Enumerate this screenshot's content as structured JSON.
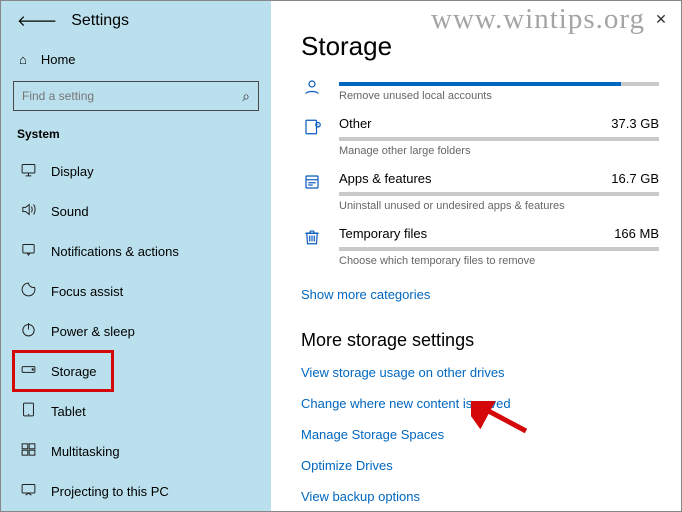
{
  "watermark": "www.wintips.org",
  "app_title": "Settings",
  "home_label": "Home",
  "search_placeholder": "Find a setting",
  "group_label": "System",
  "nav": [
    {
      "id": "display",
      "label": "Display"
    },
    {
      "id": "sound",
      "label": "Sound"
    },
    {
      "id": "notifications",
      "label": "Notifications & actions"
    },
    {
      "id": "focus",
      "label": "Focus assist"
    },
    {
      "id": "power",
      "label": "Power & sleep"
    },
    {
      "id": "storage",
      "label": "Storage"
    },
    {
      "id": "tablet",
      "label": "Tablet"
    },
    {
      "id": "multitasking",
      "label": "Multitasking"
    },
    {
      "id": "projecting",
      "label": "Projecting to this PC"
    }
  ],
  "page_title": "Storage",
  "categories": [
    {
      "id": "accounts",
      "name": "",
      "size": "",
      "sub": "Remove unused local accounts",
      "fill": 88
    },
    {
      "id": "other",
      "name": "Other",
      "size": "37.3 GB",
      "sub": "Manage other large folders",
      "fill": 0
    },
    {
      "id": "apps",
      "name": "Apps & features",
      "size": "16.7 GB",
      "sub": "Uninstall unused or undesired apps & features",
      "fill": 0
    },
    {
      "id": "temp",
      "name": "Temporary files",
      "size": "166 MB",
      "sub": "Choose which temporary files to remove",
      "fill": 0
    }
  ],
  "show_more": "Show more categories",
  "more_title": "More storage settings",
  "links": [
    "View storage usage on other drives",
    "Change where new content is saved",
    "Manage Storage Spaces",
    "Optimize Drives",
    "View backup options"
  ]
}
